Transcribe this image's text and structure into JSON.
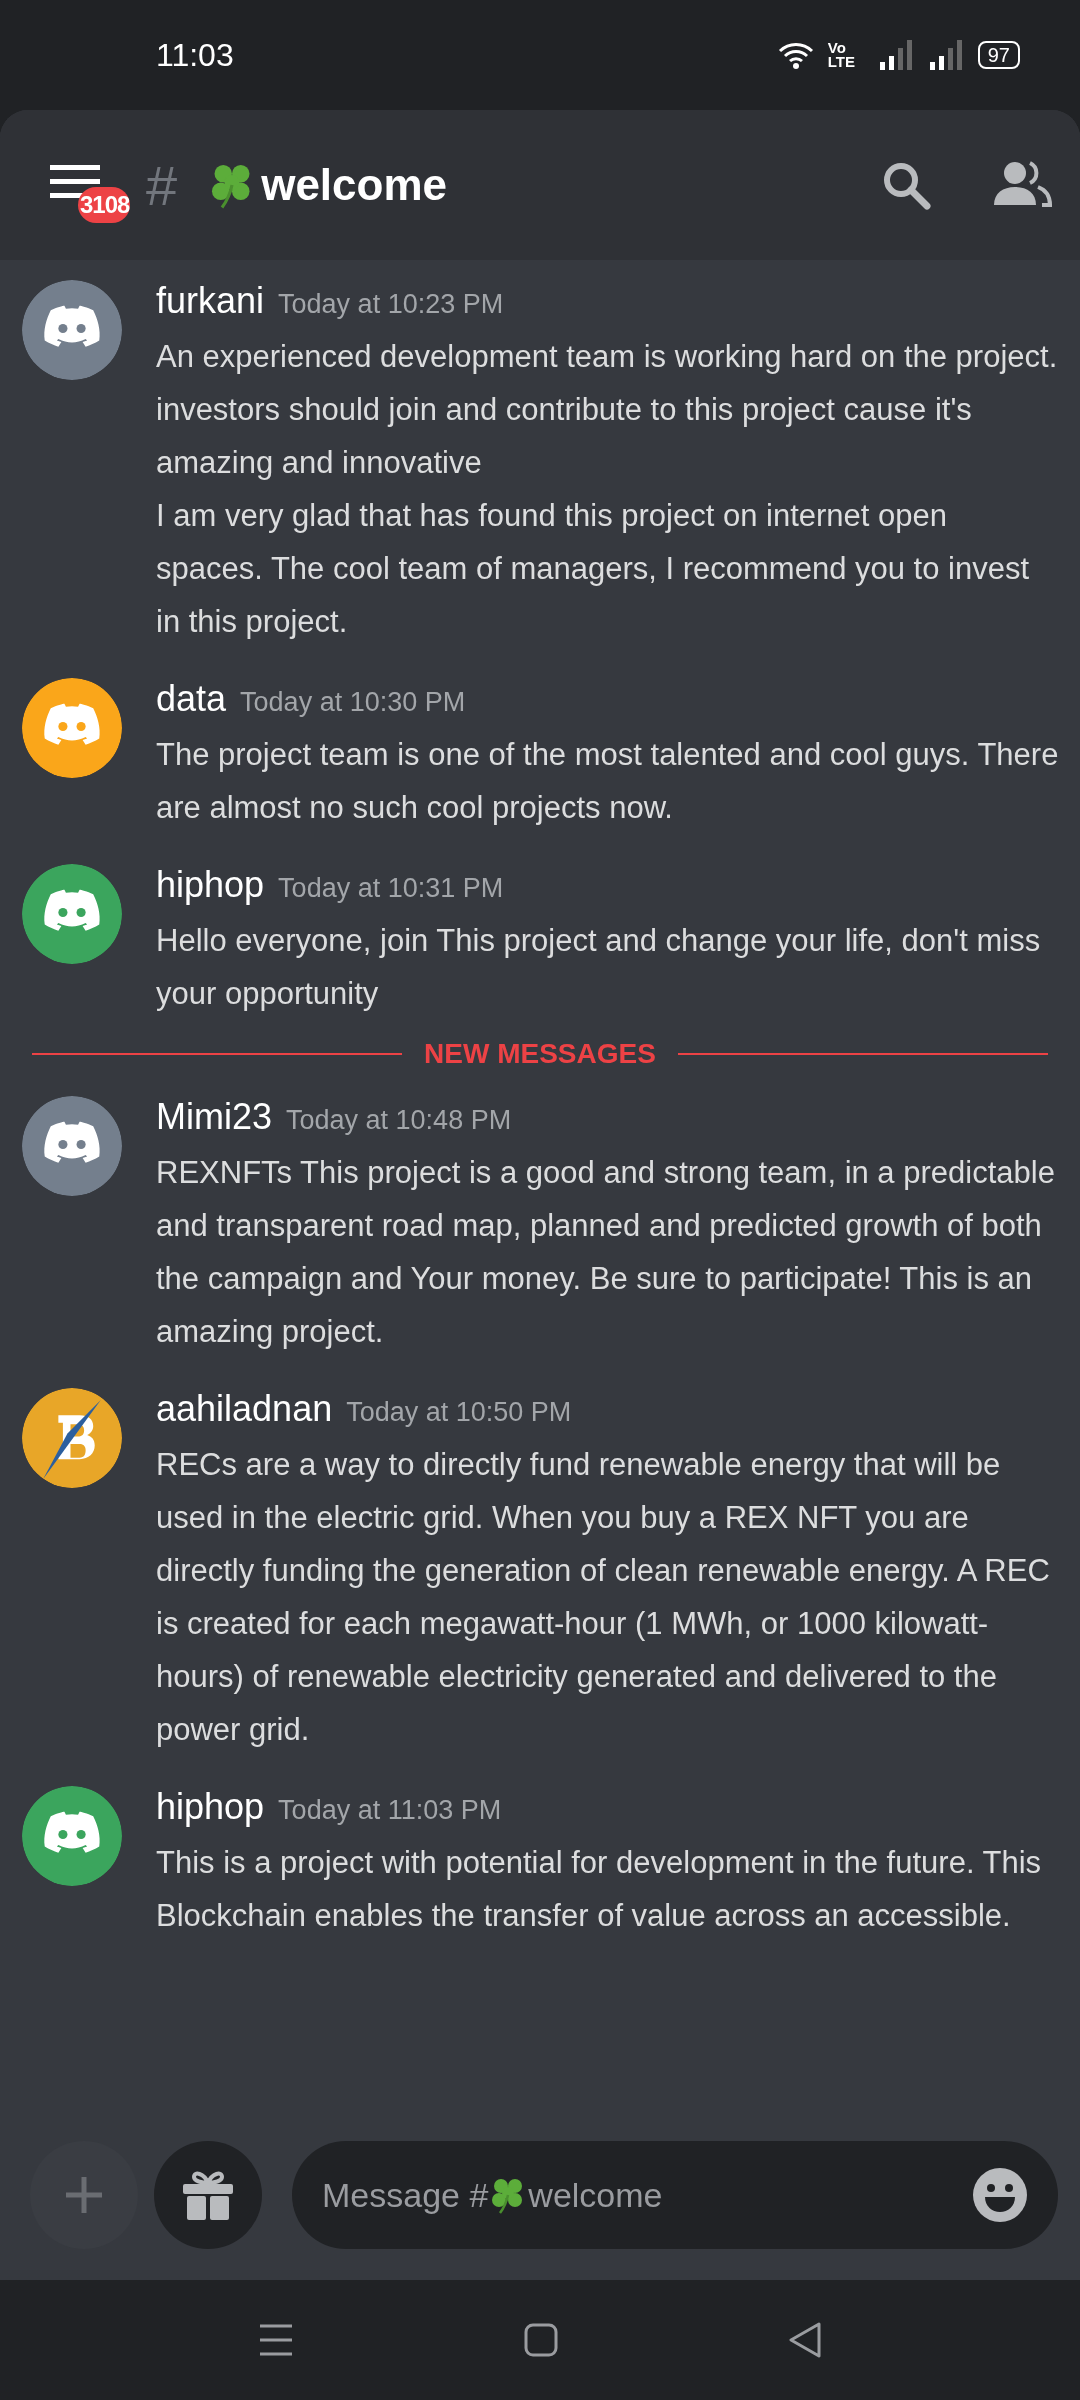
{
  "status_bar": {
    "time": "11:03",
    "network": "Vo LTE",
    "battery": "97"
  },
  "header": {
    "menu_badge": "3108",
    "hash": "#",
    "channel": "welcome"
  },
  "messages": [
    {
      "kind": "message",
      "author": "furkani",
      "time": "Today at 10:23 PM",
      "avatar": {
        "kind": "discord",
        "color": "#747f8d"
      },
      "paragraphs": [
        "An experienced development team is working hard on the project. investors should join and contribute to this project cause it's amazing and innovative",
        "I am very glad that has found this project on internet open spaces. The cool team of managers, I recommend you to invest in this project."
      ]
    },
    {
      "kind": "message",
      "author": "data",
      "time": "Today at 10:30 PM",
      "avatar": {
        "kind": "discord",
        "color": "#faa61a"
      },
      "paragraphs": [
        "The project team is one of the most talented and cool guys. There are almost no such cool projects now."
      ]
    },
    {
      "kind": "message",
      "author": "hiphop",
      "time": "Today at 10:31 PM",
      "avatar": {
        "kind": "discord",
        "color": "#3ba55d"
      },
      "paragraphs": [
        "Hello everyone, join This project and change your life, don't miss your opportunity"
      ]
    },
    {
      "kind": "divider",
      "label": "NEW MESSAGES"
    },
    {
      "kind": "message",
      "author": "Mimi23",
      "time": "Today at 10:48 PM",
      "avatar": {
        "kind": "discord",
        "color": "#747f8d"
      },
      "paragraphs": [
        "REXNFTs This project is a good and strong team, in a predictable and transparent road map, planned and predicted growth of both the campaign and Your money. Be sure to participate! This is an amazing project."
      ]
    },
    {
      "kind": "message",
      "author": "aahiladnan",
      "time": "Today at 10:50 PM",
      "avatar": {
        "kind": "bitcoin",
        "color": "#e8a628"
      },
      "paragraphs": [
        "RECs are a way to directly fund renewable energy that will be used in the electric grid. When you buy a REX NFT you are directly funding the generation of clean renewable energy. A REC is created for each megawatt-hour (1 MWh, or 1000 kilowatt-hours) of renewable electricity generated and delivered to the power grid."
      ]
    },
    {
      "kind": "message",
      "author": "hiphop",
      "time": "Today at 11:03 PM",
      "avatar": {
        "kind": "discord",
        "color": "#3ba55d"
      },
      "paragraphs": [
        "This is a project with potential for development in the future. This Blockchain enables the transfer of value across an accessible."
      ]
    }
  ],
  "composer": {
    "placeholder_start": "Message #",
    "placeholder_end": "welcome"
  }
}
